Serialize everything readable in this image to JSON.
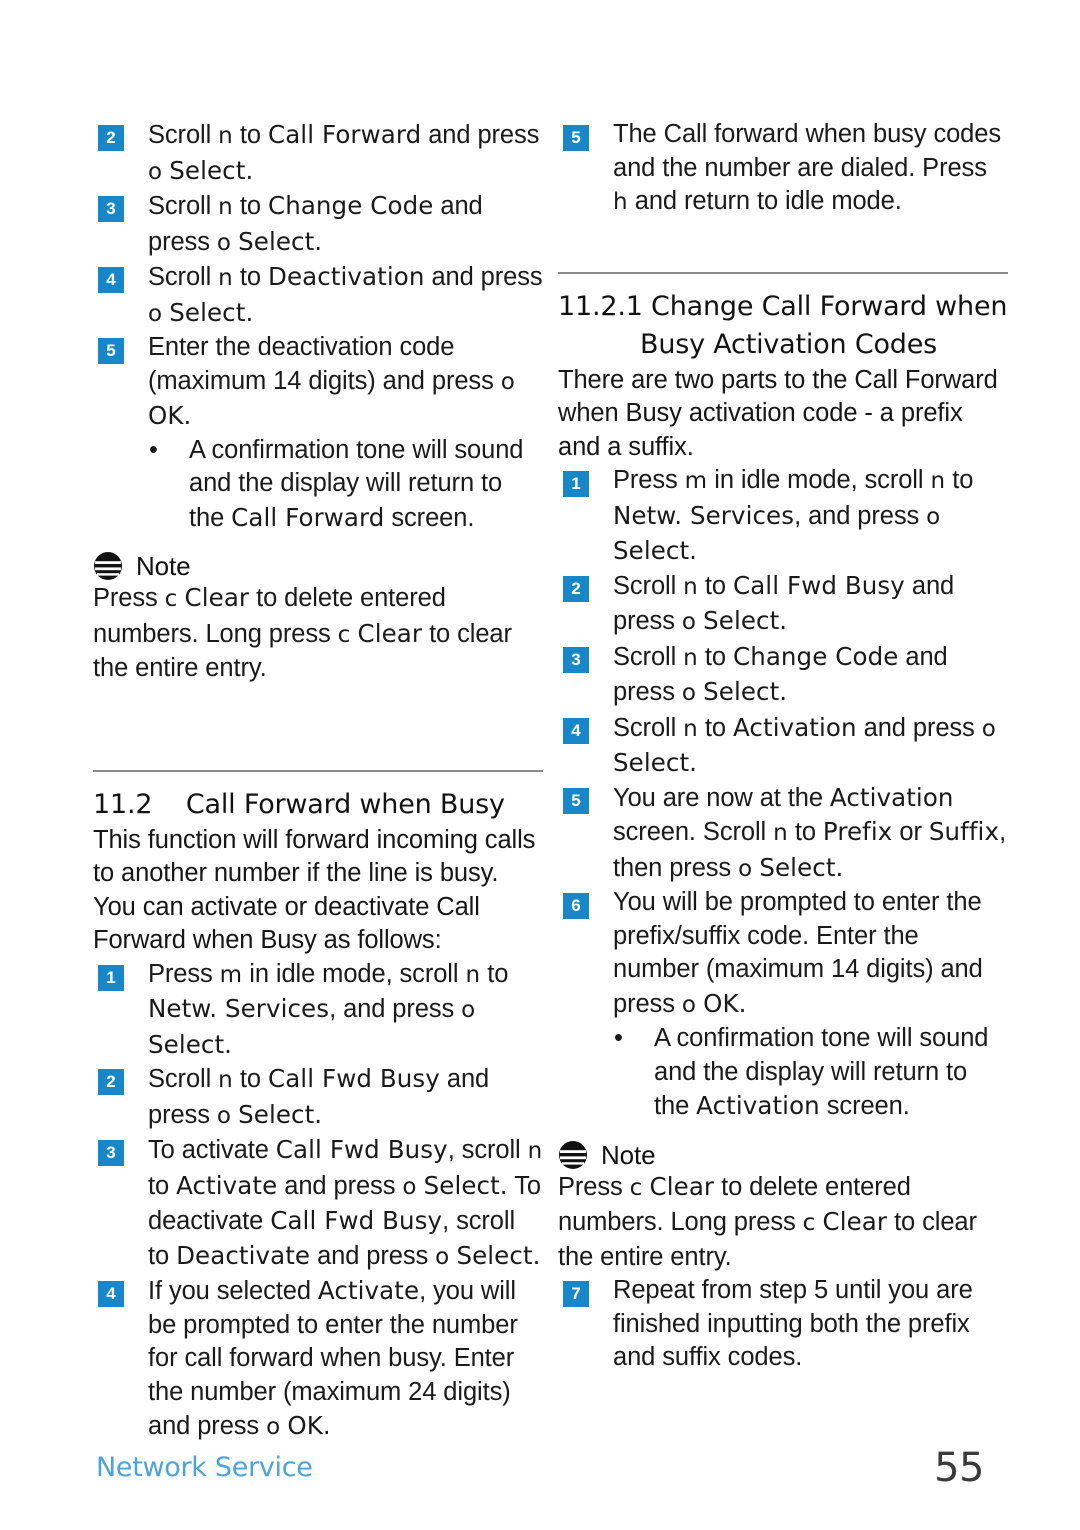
{
  "page": {
    "number": "55",
    "footer_label": "Network Service",
    "accent_blue": "#1787c9",
    "footer_blue": "#4ba3dc",
    "rule_color": "#8b8b8b"
  },
  "note_icon_name": "note-icon",
  "left_column": {
    "steps_top": [
      {
        "num": "2",
        "parts": [
          {
            "t": "Scroll ",
            "s": "body"
          },
          {
            "t": "n",
            "s": "key"
          },
          {
            "t": "  to ",
            "s": "body"
          },
          {
            "t": "Call Forward",
            "s": "ui"
          },
          {
            "t": " and press ",
            "s": "body"
          },
          {
            "t": "o",
            "s": "key"
          },
          {
            "t": "  ",
            "s": "body"
          },
          {
            "t": "Select.",
            "s": "ui"
          }
        ]
      },
      {
        "num": "3",
        "parts": [
          {
            "t": "Scroll ",
            "s": "body"
          },
          {
            "t": "n",
            "s": "key"
          },
          {
            "t": "  to ",
            "s": "body"
          },
          {
            "t": "Change Code",
            "s": "ui"
          },
          {
            "t": " and press ",
            "s": "body"
          },
          {
            "t": "o",
            "s": "key"
          },
          {
            "t": "  ",
            "s": "body"
          },
          {
            "t": "Select.",
            "s": "ui"
          }
        ]
      },
      {
        "num": "4",
        "parts": [
          {
            "t": "Scroll ",
            "s": "body"
          },
          {
            "t": "n",
            "s": "key"
          },
          {
            "t": "  to ",
            "s": "body"
          },
          {
            "t": "Deactivation",
            "s": "ui"
          },
          {
            "t": " and press ",
            "s": "body"
          },
          {
            "t": "o",
            "s": "key"
          },
          {
            "t": "  ",
            "s": "body"
          },
          {
            "t": "Select.",
            "s": "ui"
          }
        ]
      },
      {
        "num": "5",
        "parts": [
          {
            "t": "Enter the deactivation code (maximum 14 digits) and press ",
            "s": "body"
          },
          {
            "t": "o",
            "s": "key"
          },
          {
            "t": "  ",
            "s": "body"
          },
          {
            "t": "OK.",
            "s": "ui"
          }
        ]
      }
    ],
    "bullet": {
      "dot": "•",
      "parts": [
        {
          "t": "A confirmation tone will sound and the display will return to the ",
          "s": "body"
        },
        {
          "t": "Call Forward",
          "s": "ui"
        },
        {
          "t": " screen.",
          "s": "body"
        }
      ]
    },
    "note": {
      "title": "Note",
      "parts": [
        {
          "t": "Press ",
          "s": "body"
        },
        {
          "t": "c",
          "s": "key"
        },
        {
          "t": "  ",
          "s": "body"
        },
        {
          "t": "Clear",
          "s": "ui"
        },
        {
          "t": " to delete entered numbers. Long press ",
          "s": "body"
        },
        {
          "t": "c",
          "s": "key"
        },
        {
          "t": "  ",
          "s": "body"
        },
        {
          "t": "Clear",
          "s": "ui"
        },
        {
          "t": " to clear the entire entry.",
          "s": "body"
        }
      ]
    },
    "section_heading": "11.2    Call Forward when Busy",
    "section_intro": "This function will forward incoming calls to another number if the line is busy. You can activate or deactivate Call Forward when Busy as follows:",
    "steps_bottom": [
      {
        "num": "1",
        "parts": [
          {
            "t": "Press ",
            "s": "body"
          },
          {
            "t": "m",
            "s": "key"
          },
          {
            "t": "  in idle mode, scroll ",
            "s": "body"
          },
          {
            "t": "n",
            "s": "key"
          },
          {
            "t": "  to ",
            "s": "body"
          },
          {
            "t": "Netw. Services",
            "s": "ui"
          },
          {
            "t": ", and press ",
            "s": "body"
          },
          {
            "t": "o",
            "s": "key"
          },
          {
            "t": "  ",
            "s": "body"
          },
          {
            "t": "Select.",
            "s": "ui"
          }
        ]
      },
      {
        "num": "2",
        "parts": [
          {
            "t": "Scroll ",
            "s": "body"
          },
          {
            "t": "n",
            "s": "key"
          },
          {
            "t": "  to ",
            "s": "body"
          },
          {
            "t": "Call Fwd Busy",
            "s": "ui"
          },
          {
            "t": " and press ",
            "s": "body"
          },
          {
            "t": "o",
            "s": "key"
          },
          {
            "t": "  ",
            "s": "body"
          },
          {
            "t": "Select.",
            "s": "ui"
          }
        ]
      },
      {
        "num": "3",
        "parts": [
          {
            "t": "To activate ",
            "s": "body"
          },
          {
            "t": "Call Fwd Busy",
            "s": "ui"
          },
          {
            "t": ", scroll ",
            "s": "body"
          },
          {
            "t": "n",
            "s": "key"
          },
          {
            "t": "  to ",
            "s": "body"
          },
          {
            "t": "Activate",
            "s": "ui"
          },
          {
            "t": " and press ",
            "s": "body"
          },
          {
            "t": "o",
            "s": "key"
          },
          {
            "t": "  ",
            "s": "body"
          },
          {
            "t": "Select.",
            "s": "ui"
          },
          {
            "t": " To deactivate ",
            "s": "body"
          },
          {
            "t": "Call Fwd Busy",
            "s": "ui"
          },
          {
            "t": ", scroll to ",
            "s": "body"
          },
          {
            "t": "Deactivate",
            "s": "ui"
          },
          {
            "t": " and press ",
            "s": "body"
          },
          {
            "t": "o",
            "s": "key"
          },
          {
            "t": "  ",
            "s": "body"
          },
          {
            "t": "Select.",
            "s": "ui"
          }
        ]
      },
      {
        "num": "4",
        "parts": [
          {
            "t": "If you selected ",
            "s": "body"
          },
          {
            "t": "Activate",
            "s": "ui"
          },
          {
            "t": ", you will be prompted to enter the number for call forward when busy. Enter the number (maximum 24 digits) and press ",
            "s": "body"
          },
          {
            "t": "o",
            "s": "key"
          },
          {
            "t": "  ",
            "s": "body"
          },
          {
            "t": "OK.",
            "s": "ui"
          }
        ]
      }
    ]
  },
  "right_column": {
    "step_top": {
      "num": "5",
      "parts": [
        {
          "t": "The Call forward when busy codes and the number are dialed. Press ",
          "s": "body"
        },
        {
          "t": "h",
          "s": "key"
        },
        {
          "t": "  and return to idle mode.",
          "s": "body"
        }
      ]
    },
    "subsection_heading_line1": "11.2.1 Change Call Forward when",
    "subsection_heading_line2": "Busy Activation Codes",
    "subsection_intro": "There are two parts to the Call Forward when Busy activation code - a prefix and a suffix.",
    "steps": [
      {
        "num": "1",
        "parts": [
          {
            "t": "Press ",
            "s": "body"
          },
          {
            "t": "m",
            "s": "key"
          },
          {
            "t": "  in idle mode, scroll ",
            "s": "body"
          },
          {
            "t": "n",
            "s": "key"
          },
          {
            "t": "  to ",
            "s": "body"
          },
          {
            "t": "Netw. Services",
            "s": "ui"
          },
          {
            "t": ", and press ",
            "s": "body"
          },
          {
            "t": "o",
            "s": "key"
          },
          {
            "t": "  ",
            "s": "body"
          },
          {
            "t": "Select.",
            "s": "ui"
          }
        ]
      },
      {
        "num": "2",
        "parts": [
          {
            "t": "Scroll ",
            "s": "body"
          },
          {
            "t": "n",
            "s": "key"
          },
          {
            "t": "  to ",
            "s": "body"
          },
          {
            "t": "Call Fwd Busy",
            "s": "ui"
          },
          {
            "t": " and press ",
            "s": "body"
          },
          {
            "t": "o",
            "s": "key"
          },
          {
            "t": "  ",
            "s": "body"
          },
          {
            "t": "Select.",
            "s": "ui"
          }
        ]
      },
      {
        "num": "3",
        "parts": [
          {
            "t": "Scroll ",
            "s": "body"
          },
          {
            "t": "n",
            "s": "key"
          },
          {
            "t": "  to ",
            "s": "body"
          },
          {
            "t": "Change Code",
            "s": "ui"
          },
          {
            "t": " and press ",
            "s": "body"
          },
          {
            "t": "o",
            "s": "key"
          },
          {
            "t": "  ",
            "s": "body"
          },
          {
            "t": "Select.",
            "s": "ui"
          }
        ]
      },
      {
        "num": "4",
        "parts": [
          {
            "t": "Scroll ",
            "s": "body"
          },
          {
            "t": "n",
            "s": "key"
          },
          {
            "t": "  to ",
            "s": "body"
          },
          {
            "t": "Activation",
            "s": "ui"
          },
          {
            "t": " and press ",
            "s": "body"
          },
          {
            "t": "o",
            "s": "key"
          },
          {
            "t": "  ",
            "s": "body"
          },
          {
            "t": "Select.",
            "s": "ui"
          }
        ]
      },
      {
        "num": "5",
        "parts": [
          {
            "t": "You are now at the ",
            "s": "body"
          },
          {
            "t": "Activation",
            "s": "ui"
          },
          {
            "t": " screen. Scroll ",
            "s": "body"
          },
          {
            "t": "n",
            "s": "key"
          },
          {
            "t": "  to ",
            "s": "body"
          },
          {
            "t": "Prefix",
            "s": "ui"
          },
          {
            "t": " or ",
            "s": "body"
          },
          {
            "t": "Suffix",
            "s": "ui"
          },
          {
            "t": ", then press ",
            "s": "body"
          },
          {
            "t": "o",
            "s": "key"
          },
          {
            "t": "  ",
            "s": "body"
          },
          {
            "t": "Select.",
            "s": "ui"
          }
        ]
      },
      {
        "num": "6",
        "parts": [
          {
            "t": "You will be prompted to enter the prefix/suffix code. Enter the number (maximum 14 digits) and press ",
            "s": "body"
          },
          {
            "t": "o",
            "s": "key"
          },
          {
            "t": "  ",
            "s": "body"
          },
          {
            "t": "OK.",
            "s": "ui"
          }
        ]
      }
    ],
    "bullet": {
      "dot": "•",
      "parts": [
        {
          "t": "A confirmation tone will sound and the display will return to the ",
          "s": "body"
        },
        {
          "t": "Activation",
          "s": "ui"
        },
        {
          "t": " screen.",
          "s": "body"
        }
      ]
    },
    "note": {
      "title": "Note",
      "parts": [
        {
          "t": "Press ",
          "s": "body"
        },
        {
          "t": "c",
          "s": "key"
        },
        {
          "t": "  ",
          "s": "body"
        },
        {
          "t": "Clear",
          "s": "ui"
        },
        {
          "t": " to delete entered numbers. Long press ",
          "s": "body"
        },
        {
          "t": "c",
          "s": "key"
        },
        {
          "t": "  ",
          "s": "body"
        },
        {
          "t": "Clear",
          "s": "ui"
        },
        {
          "t": " to clear the entire entry.",
          "s": "body"
        }
      ]
    },
    "step_last": {
      "num": "7",
      "parts": [
        {
          "t": "Repeat from step 5 until you are finished inputting both the prefix and suffix codes.",
          "s": "body"
        }
      ]
    }
  }
}
